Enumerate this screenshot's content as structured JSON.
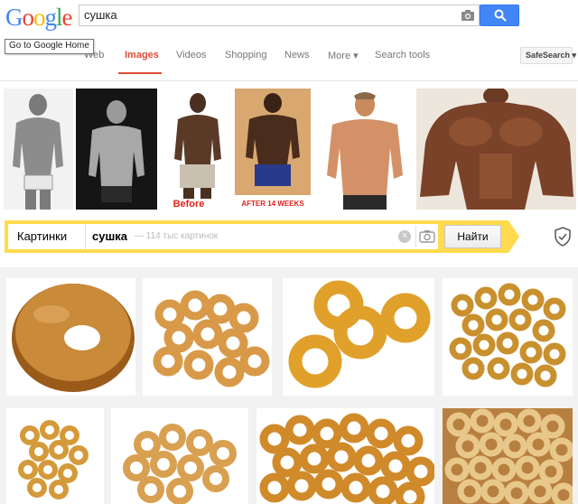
{
  "google": {
    "logo_letters": [
      {
        "ch": "G",
        "color": "#4285f4"
      },
      {
        "ch": "o",
        "color": "#ea4335"
      },
      {
        "ch": "o",
        "color": "#fbbc05"
      },
      {
        "ch": "g",
        "color": "#4285f4"
      },
      {
        "ch": "l",
        "color": "#34a853"
      },
      {
        "ch": "e",
        "color": "#ea4335"
      }
    ],
    "query": "сушка",
    "tooltip": "Go to Google Home",
    "tabs": {
      "web": "Web",
      "images": "Images",
      "videos": "Videos",
      "shopping": "Shopping",
      "news": "News",
      "more": "More ▾",
      "search_tools": "Search tools"
    },
    "safesearch": "SafeSearch ▾",
    "accent": "#dd4b39",
    "search_button_color": "#4285f4"
  },
  "yandex": {
    "tab_label": "Картинки",
    "query": "сушка",
    "hint": "— 114 тыс картинок",
    "clear_icon": "×",
    "button_label": "Найти",
    "bar_color": "#ffdb4d"
  },
  "strip_images": [
    {
      "label": "",
      "icon": "man-photo"
    },
    {
      "label": "",
      "icon": "man-photo"
    },
    {
      "label": "Before",
      "icon": "man-photo"
    },
    {
      "label": "AFTER 14 WEEKS",
      "icon": "man-photo"
    },
    {
      "label": "",
      "icon": "man-photo"
    },
    {
      "label": "",
      "icon": "man-photo"
    }
  ]
}
